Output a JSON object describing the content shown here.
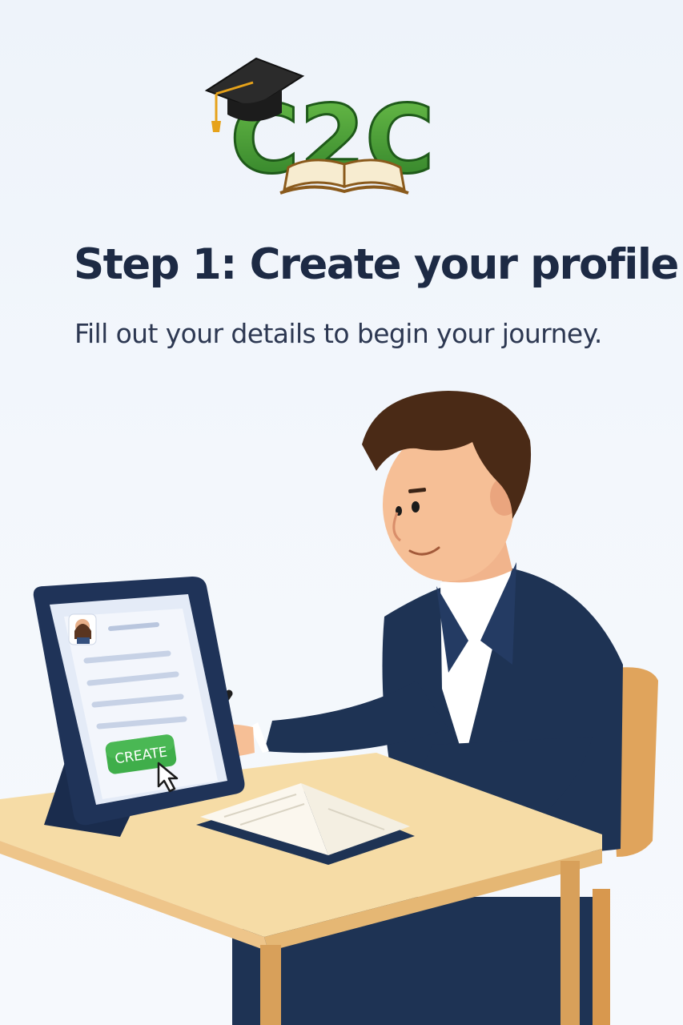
{
  "logo": {
    "text": "C2C",
    "icons": [
      "graduation-cap-icon",
      "open-book-icon"
    ],
    "colors": {
      "green": "#3f9a34",
      "gold": "#e6a21a",
      "cap": "#2a2a2a"
    }
  },
  "header": {
    "title": "Step 1: Create your profile",
    "subtitle": "Fill out your details to begin your journey."
  },
  "illustration": {
    "tablet_button_label": "CREATE",
    "colors": {
      "suit": "#1e3354",
      "desk": "#f6dca6",
      "button": "#3fae4a",
      "tablet": "#1f3358"
    }
  }
}
